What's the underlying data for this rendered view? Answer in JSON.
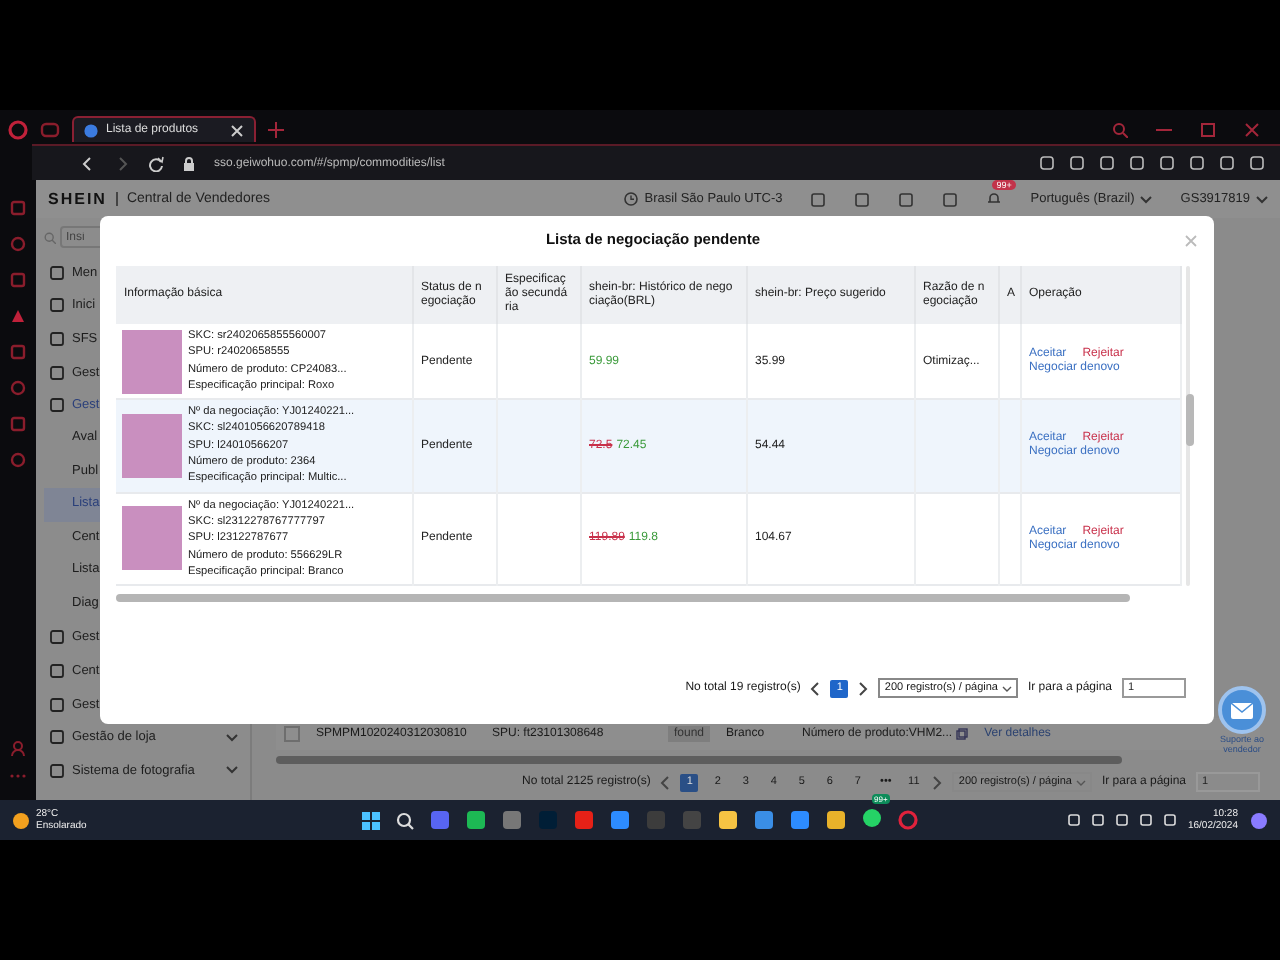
{
  "browser": {
    "tabs": [
      {
        "title": "Lista de produtos",
        "selected": true
      }
    ],
    "url": "sso.geiwohuo.com/#/spmp/commodities/list"
  },
  "header": {
    "logo": "SHEIN",
    "title": "Central de Vendedores",
    "timezone": "Brasil São Paulo UTC-3",
    "notification_badge": "99+",
    "language": "Português (Brazil)",
    "account": "GS3917819"
  },
  "sidebar": {
    "search": {
      "placeholder": "Insi"
    },
    "items": [
      {
        "label": "Men"
      },
      {
        "label": "Inici"
      },
      {
        "label": "SFS"
      },
      {
        "label": "Gest"
      },
      {
        "label": "Gest",
        "children": [
          {
            "label": "Aval",
            "selected": false
          },
          {
            "label": "Publ",
            "selected": false
          },
          {
            "label": "Lista",
            "selected": true
          },
          {
            "label": "Cent",
            "selected": false
          },
          {
            "label": "Lista",
            "selected": false
          },
          {
            "label": "Diag",
            "selected": false
          }
        ]
      },
      {
        "label": "Gest"
      },
      {
        "label": "Cent"
      },
      {
        "label": "Gest"
      },
      {
        "label": "Gestão de loja",
        "expanded": false
      },
      {
        "label": "Sistema de fotografia",
        "expanded": false
      }
    ]
  },
  "product_list": {
    "row": {
      "code": "SPMPM1020240312030810",
      "spu": "SPU: ft23101308648",
      "checked": false,
      "tag": "found",
      "spec": "Branco",
      "product_number": "Número de produto:VHM2...",
      "action": "Ver detalhes"
    },
    "pagination": {
      "total": "No total 2125 registro(s)",
      "pages": [
        {
          "label": "1",
          "selected": true
        },
        {
          "label": "2",
          "selected": false
        },
        {
          "label": "3",
          "selected": false
        },
        {
          "label": "4",
          "selected": false
        },
        {
          "label": "5",
          "selected": false
        },
        {
          "label": "6",
          "selected": false
        },
        {
          "label": "7",
          "selected": false
        },
        {
          "label": "•••",
          "selected": false
        },
        {
          "label": "11",
          "selected": false
        }
      ],
      "page_size": "200 registro(s) / página",
      "goto_label": "Ir para a página",
      "goto_value": "1"
    }
  },
  "modal": {
    "title": "Lista de negociação pendente",
    "columns": [
      "Informação básica",
      "Status de negociação",
      "Especificação secundária",
      "shein-br: Histórico de negociação(BRL)",
      "shein-br: Preço sugerido",
      "Razão de negociação",
      "A",
      "Operação"
    ],
    "rows": [
      {
        "highlighted": false,
        "details": [
          "SKC: sr2402065855560007",
          "SPU: r24020658555",
          "Número de produto: CP24083...",
          "Especificação principal: Roxo"
        ],
        "status": "Pendente",
        "history": [
          {
            "kind": "new",
            "value": "59.99"
          }
        ],
        "suggested": "35.99",
        "reason": "Otimizaç...",
        "actions": [
          {
            "kind": "accept",
            "label": "Aceitar"
          },
          {
            "kind": "reject",
            "label": "Rejeitar"
          },
          {
            "kind": "renegotiate",
            "label": "Negociar denovo"
          }
        ]
      },
      {
        "highlighted": true,
        "details": [
          "Nº da negociação: YJ01240221...",
          "SKC: sl2401056620789418",
          "SPU: l24010566207",
          "Número de produto: 2364",
          "Especificação principal: Multic..."
        ],
        "status": "Pendente",
        "history": [
          {
            "kind": "old",
            "value": "72.5"
          },
          {
            "kind": "new",
            "value": "72.45"
          }
        ],
        "suggested": "54.44",
        "actions": [
          {
            "kind": "accept",
            "label": "Aceitar"
          },
          {
            "kind": "reject",
            "label": "Rejeitar"
          },
          {
            "kind": "renegotiate",
            "label": "Negociar denovo"
          }
        ]
      },
      {
        "highlighted": false,
        "details": [
          "Nº da negociação: YJ01240221...",
          "SKC: sl2312278767777797",
          "SPU: l23122787677",
          "Número de produto: 556629LR",
          "Especificação principal: Branco"
        ],
        "status": "Pendente",
        "history": [
          {
            "kind": "old",
            "value": "119.89"
          },
          {
            "kind": "new",
            "value": "119.8"
          }
        ],
        "suggested": "104.67",
        "actions": [
          {
            "kind": "accept",
            "label": "Aceitar"
          },
          {
            "kind": "reject",
            "label": "Rejeitar"
          },
          {
            "kind": "renegotiate",
            "label": "Negociar denovo"
          }
        ]
      }
    ],
    "pagination": {
      "total": "No total 19 registro(s)",
      "pages": [
        {
          "label": "1",
          "selected": true
        }
      ],
      "page_size": "200 registro(s) / página",
      "goto_label": "Ir para a página",
      "goto_value": "1"
    }
  },
  "support": {
    "label": "Suporte ao vendedor"
  },
  "taskbar": {
    "weather": {
      "temp": "28°C",
      "condition": "Ensolarado"
    },
    "app_badge": "99+",
    "time": "10:28",
    "date": "16/02/2024"
  }
}
